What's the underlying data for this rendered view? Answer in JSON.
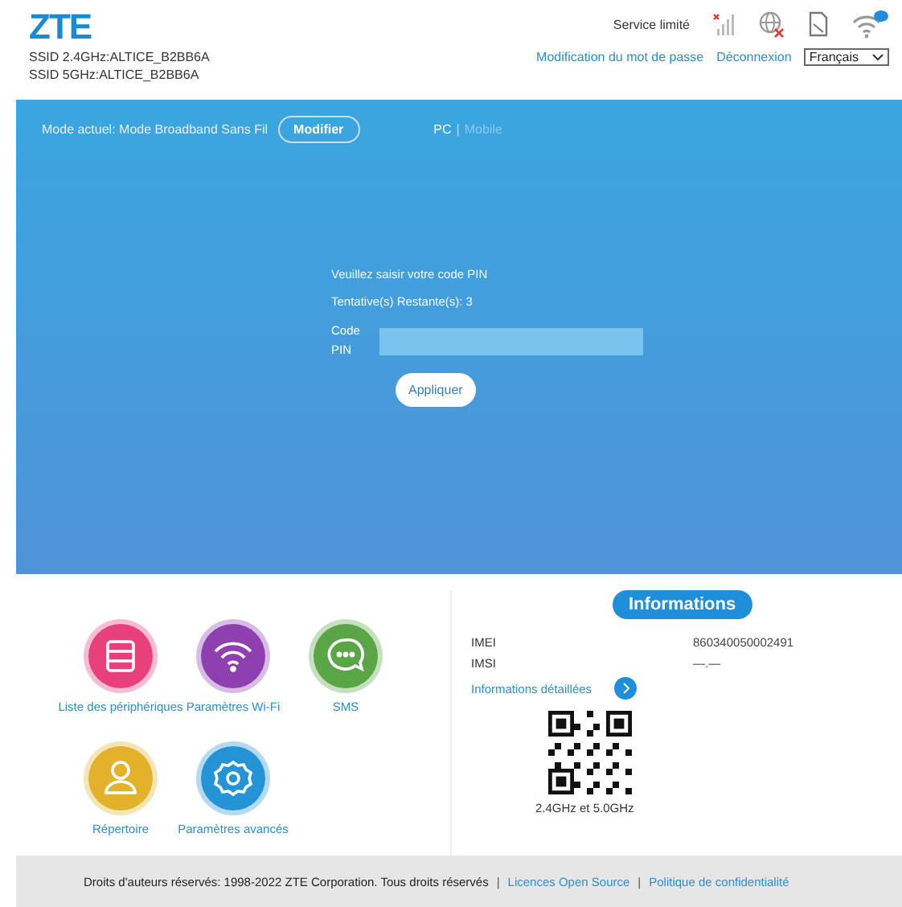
{
  "header": {
    "logo": "ZTE",
    "ssids": [
      "SSID 2.4GHz:ALTICE_B2BB6A",
      "SSID 5GHz:ALTICE_B2BB6A"
    ],
    "service_status": "Service limité",
    "links": [
      "Modification du mot de passe",
      "Déconnexion"
    ],
    "language": "Français"
  },
  "mode_bar": {
    "label": "Mode actuel: Mode Broadband Sans Fil",
    "button": "Modifier",
    "view_separator": "|",
    "views": [
      {
        "label": "PC",
        "selected": true
      },
      {
        "label": "Mobile",
        "selected": false
      }
    ]
  },
  "pin_form": {
    "prompt": "Veuillez saisir votre code PIN",
    "attempts": "Tentative(s) Restante(s): 3",
    "field_label": "Code PIN",
    "button": "Appliquer"
  },
  "shortcuts": [
    {
      "kind": "devices",
      "label": "Liste des périphériques",
      "color": "#e8407a"
    },
    {
      "kind": "wifi",
      "label": "Paramètres Wi-Fi",
      "color": "#8e3fb0"
    },
    {
      "kind": "sms",
      "label": "SMS",
      "color": "#5aa646"
    },
    {
      "kind": "contacts",
      "label": "Répertoire",
      "color": "#e3b22a"
    },
    {
      "kind": "settings",
      "label": "Paramètres avancés",
      "color": "#2594d6"
    }
  ],
  "info": {
    "title": "Informations",
    "rows": [
      {
        "label": "IMEI",
        "value": "860340050002491"
      },
      {
        "label": "IMSI",
        "value": "—.—"
      }
    ],
    "details_link": "Informations détaillées",
    "qr_caption": "2.4GHz et 5.0GHz"
  },
  "footer": {
    "copyright": "Droits d'auteurs réservés: 1998-2022 ZTE Corporation. Tous droits réservés",
    "separator": "|",
    "links": [
      "Licences Open Source",
      "Politique de confidentialité"
    ]
  }
}
